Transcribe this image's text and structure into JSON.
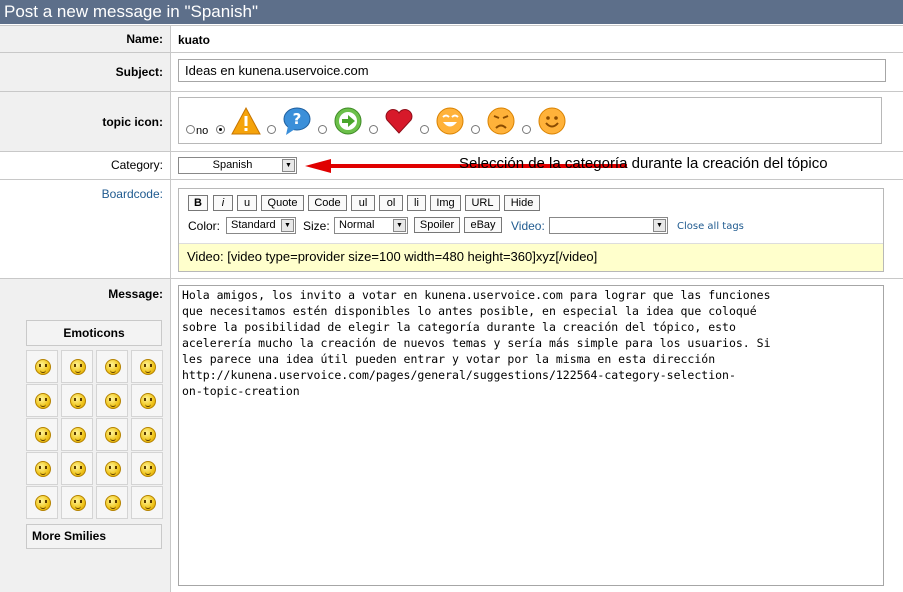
{
  "header": {
    "title": "Post a new message in \"Spanish\""
  },
  "name": {
    "label": "Name:",
    "value": "kuato"
  },
  "subject": {
    "label": "Subject:",
    "value": "Ideas en kunena.uservoice.com"
  },
  "topic_icon": {
    "label": "topic icon:",
    "no_label": "no",
    "icons": [
      "warning-icon",
      "question-bubble-icon",
      "arrow-right-icon",
      "heart-icon",
      "laughing-face-icon",
      "sad-face-icon",
      "smile-face-icon"
    ],
    "selected": "warning-icon"
  },
  "category": {
    "label": "Category:",
    "selected": "Spanish",
    "annotation": "Selección de la categoría durante la creación del tópico",
    "annotation_color": "#e00000"
  },
  "boardcode": {
    "label": "Boardcode:",
    "buttons": [
      "B",
      "i",
      "u",
      "Quote",
      "Code",
      "ul",
      "ol",
      "li",
      "Img",
      "URL",
      "Hide"
    ],
    "color_label": "Color:",
    "color_value": "Standard",
    "size_label": "Size:",
    "size_value": "Normal",
    "spoiler_label": "Spoiler",
    "ebay_label": "eBay",
    "video_label": "Video:",
    "video_value": "",
    "close_all_label": "Close all tags",
    "help_text": "Video: [video type=provider size=100 width=480 height=360]xyz[/video]"
  },
  "message": {
    "label": "Message:",
    "text": "Hola amigos, los invito a votar en kunena.uservoice.com para lograr que las funciones\nque necesitamos estén disponibles lo antes posible, en especial la idea que coloqué\nsobre la posibilidad de elegir la categoría durante la creación del tópico, esto\nacelerería mucho la creación de nuevos temas y sería más simple para los usuarios. Si\nles parece una idea útil pueden entrar y votar por la misma en esta dirección\nhttp://kunena.uservoice.com/pages/general/suggestions/122564-category-selection-\non-topic-creation"
  },
  "emoticons": {
    "title": "Emoticons",
    "smileys": [
      "cool-smiley-icon",
      "worried-smiley-icon",
      "smile-smiley-icon",
      "grin-smiley-icon",
      "happy-smiley-icon",
      "wink-smiley-icon",
      "tongue-smiley-icon",
      "angry-smiley-icon",
      "shocked-smiley-icon",
      "surprised-smiley-icon",
      "confused-smiley-icon",
      "dizzy-smiley-icon",
      "laugh-smiley-icon",
      "blush-smiley-icon",
      "rolleyes-smiley-icon",
      "sad-smiley-icon",
      "oops-smiley-icon",
      "big-grin-smiley-icon",
      "neutral-smiley-icon",
      "crazy-smiley-icon"
    ],
    "more_label": "More Smilies"
  }
}
